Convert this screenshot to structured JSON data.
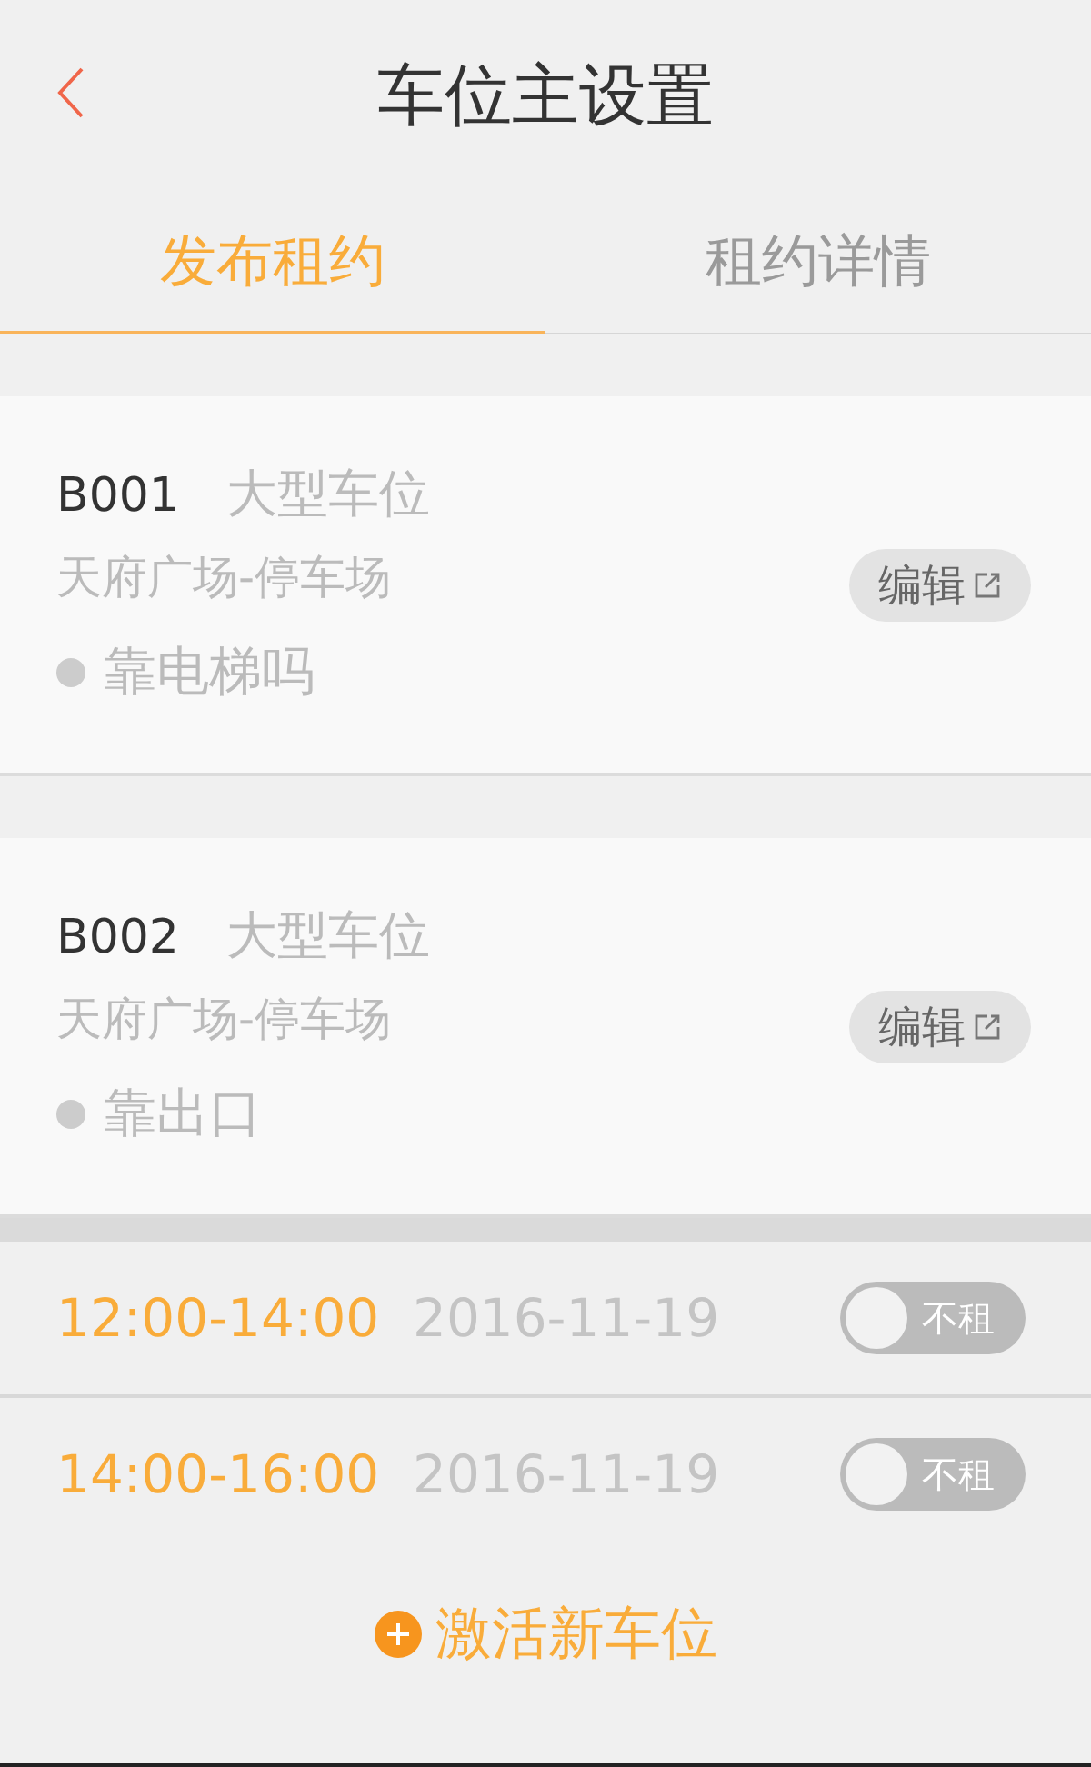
{
  "header": {
    "title": "车位主设置"
  },
  "tabs": [
    {
      "label": "发布租约",
      "selected": true
    },
    {
      "label": "租约详情",
      "selected": false
    }
  ],
  "spaces": [
    {
      "code": "B001",
      "type": "大型车位",
      "location": "天府广场-停车场",
      "feature": "靠电梯吗",
      "edit": "编辑"
    },
    {
      "code": "B002",
      "type": "大型车位",
      "location": "天府广场-停车场",
      "feature": "靠出口",
      "edit": "编辑"
    }
  ],
  "slots": [
    {
      "time": "12:00-14:00",
      "date": "2016-11-19",
      "toggle": {
        "label": "不租",
        "on": false
      }
    },
    {
      "time": "14:00-16:00",
      "date": "2016-11-19",
      "toggle": {
        "label": "不租",
        "on": false
      }
    }
  ],
  "add_button": "激活新车位"
}
